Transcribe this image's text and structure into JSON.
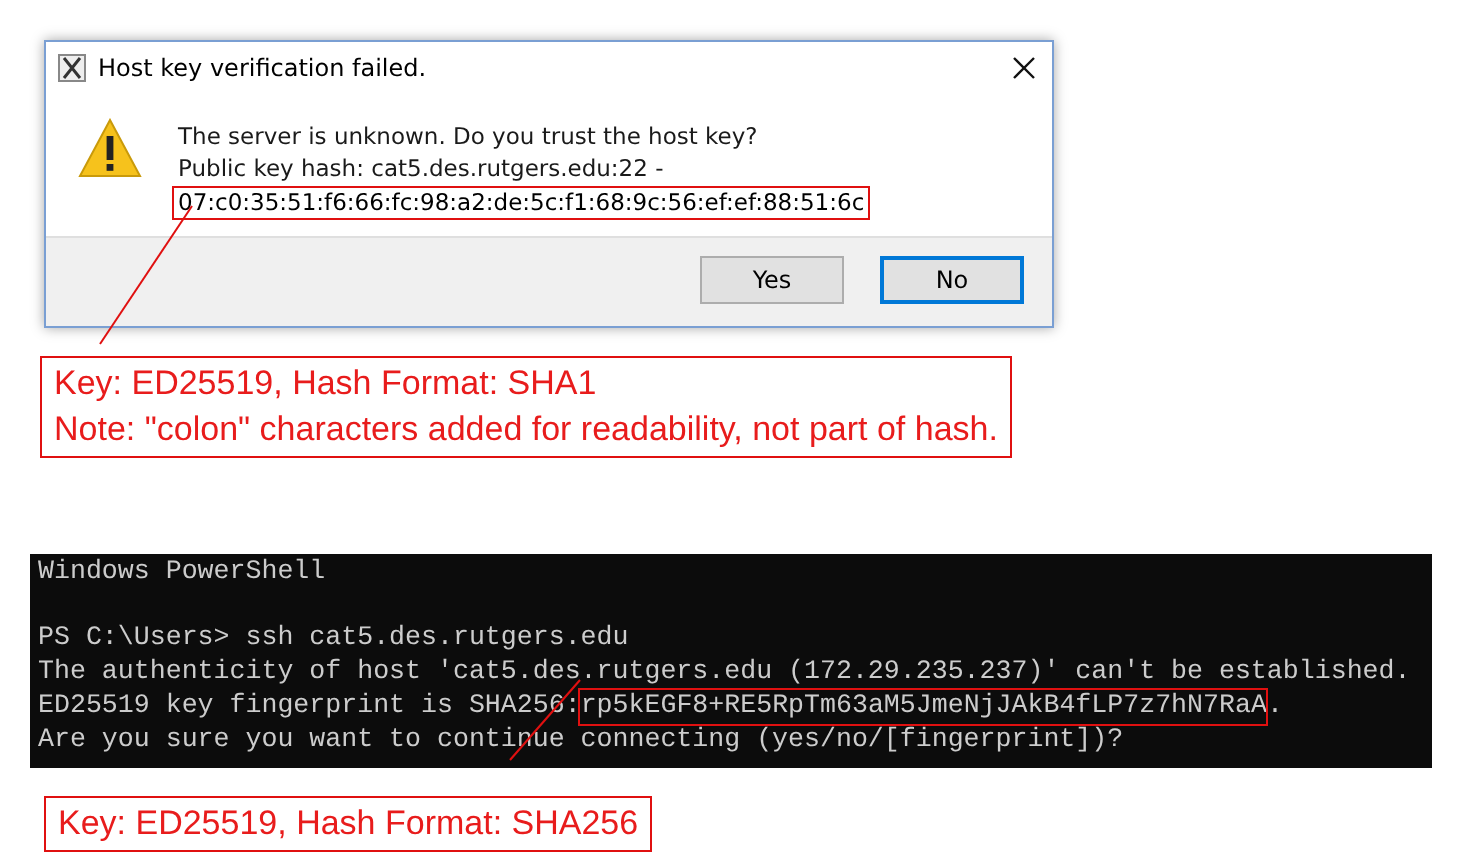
{
  "dialog": {
    "title": "Host key verification failed.",
    "message": [
      "The server is unknown. Do you trust the host key?",
      "Public key hash: cat5.des.rutgers.edu:22 -"
    ],
    "hash": "07:c0:35:51:f6:66:fc:98:a2:de:5c:f1:68:9c:56:ef:ef:88:51:6c",
    "buttons": [
      {
        "label": "Yes",
        "selected": false
      },
      {
        "label": "No",
        "selected": true
      }
    ]
  },
  "annotation_1": {
    "lines": [
      "Key: ED25519, Hash Format: SHA1",
      "Note: \"colon\" characters added for readability, not part of hash."
    ]
  },
  "terminal": {
    "title": "Windows PowerShell",
    "lines": [
      {
        "kind": "plain",
        "text": "PS C:\\Users> ssh cat5.des.rutgers.edu"
      },
      {
        "kind": "plain",
        "text": "The authenticity of host 'cat5.des.rutgers.edu (172.29.235.237)' can't be established."
      },
      {
        "kind": "marked",
        "prefix": "ED25519 key fingerprint is SHA256:",
        "highlight": "rp5kEGF8+RE5RpTm63aM5JmeNjJAkB4fLP7z7hN7RaA",
        "suffix": "."
      },
      {
        "kind": "plain",
        "text": "Are you sure you want to continue connecting (yes/no/[fingerprint])?"
      }
    ]
  },
  "annotation_2": {
    "lines": [
      "Key: ED25519, Hash Format: SHA256"
    ]
  }
}
